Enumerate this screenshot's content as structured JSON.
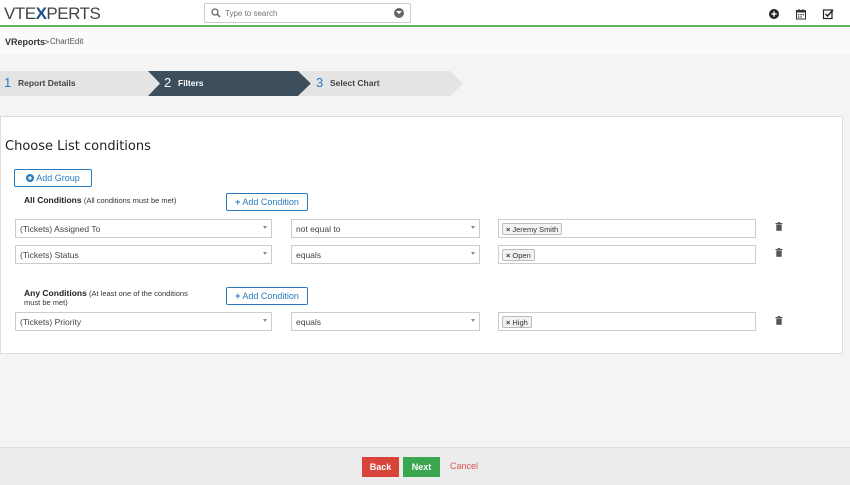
{
  "header": {
    "logo_left": "VTE",
    "logo_x": "X",
    "logo_right": "PERTS",
    "search_placeholder": "Type to search"
  },
  "breadcrumb": {
    "root": "VReports",
    "separator": ">",
    "current": "ChartEdit"
  },
  "steps": [
    {
      "num": "1",
      "label": "Report Details"
    },
    {
      "num": "2",
      "label": "Filters"
    },
    {
      "num": "3",
      "label": "Select Chart"
    }
  ],
  "main": {
    "title": "Choose List conditions",
    "add_group": "Add Group",
    "all": {
      "heading": "All Conditions",
      "sub": "(All conditions must be met)",
      "add_condition": "Add Condition",
      "rows": [
        {
          "field": "(Tickets) Assigned To",
          "op": "not equal to",
          "value": "Jeremy Smith"
        },
        {
          "field": "(Tickets) Status",
          "op": "equals",
          "value": "Open"
        }
      ]
    },
    "any": {
      "heading": "Any Conditions",
      "sub_line1": "(At least one of the conditions",
      "sub_line2": "must be met)",
      "add_condition": "Add Condition",
      "rows": [
        {
          "field": "(Tickets) Priority",
          "op": "equals",
          "value": "High"
        }
      ]
    }
  },
  "footer": {
    "back": "Back",
    "next": "Next",
    "cancel": "Cancel"
  },
  "colors": {
    "accent": "#2a7ac0",
    "active_step": "#3d4e5c",
    "back": "#d9443a",
    "next": "#3aa650",
    "topline": "#5cb85c"
  }
}
